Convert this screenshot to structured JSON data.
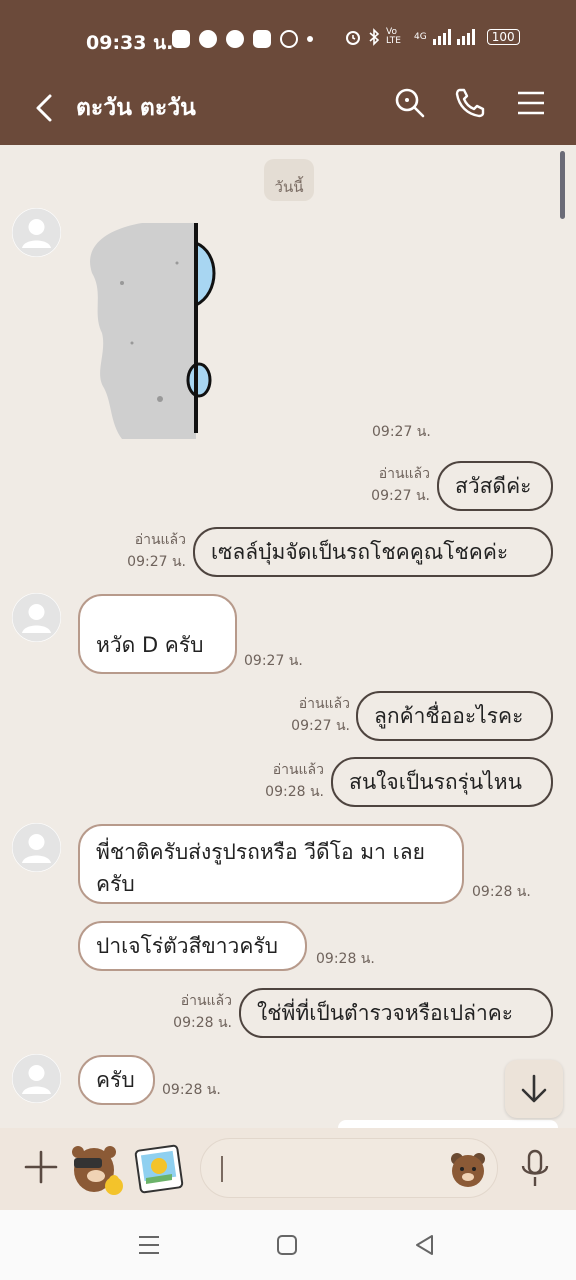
{
  "status": {
    "time": "09:33 น.",
    "net_label": "Vo LTE",
    "net_4g": "4G",
    "battery": "100"
  },
  "header": {
    "title": "ตะวัน ตะวัน"
  },
  "chat": {
    "date_label": "วันนี้",
    "messages": [
      {
        "kind": "sticker",
        "side": "in",
        "time": "09:27 น."
      },
      {
        "side": "out",
        "text": "สวัสดีค่ะ",
        "read": "อ่านแล้ว",
        "time": "09:27 น."
      },
      {
        "side": "out",
        "text": "เซลล์บุ๋มจัดเป็นรถโชคคูณโชคค่ะ",
        "read": "อ่านแล้ว",
        "time": "09:27 น."
      },
      {
        "side": "in",
        "text": "หวัด D ครับ",
        "time": "09:27 น."
      },
      {
        "side": "out",
        "text": "ลูกค้าชื่ออะไรคะ",
        "read": "อ่านแล้ว",
        "time": "09:27 น."
      },
      {
        "side": "out",
        "text": "สนใจเป็นรถรุ่นไหน",
        "read": "อ่านแล้ว",
        "time": "09:28 น."
      },
      {
        "side": "in",
        "text": "พี่ชาติครับส่งรูปรถหรือ วีดีโอ มา เลยครับ",
        "time": "09:28 น."
      },
      {
        "side": "in",
        "text": "ปาเจโร่ตัวสีขาวครับ",
        "time": "09:28 น."
      },
      {
        "side": "out",
        "text": "ใช่พี่ที่เป็นตำรวจหรือเปล่าคะ",
        "read": "อ่านแล้ว",
        "time": "09:28 น."
      },
      {
        "side": "in",
        "text": "ครับ",
        "time": "09:28 น."
      }
    ]
  },
  "input": {
    "value": "",
    "placeholder": ""
  },
  "colors": {
    "header": "#6b4a3a",
    "chat_bg": "#f0ebe5",
    "in_border": "#b79a8b",
    "out_border": "#4e443f"
  }
}
